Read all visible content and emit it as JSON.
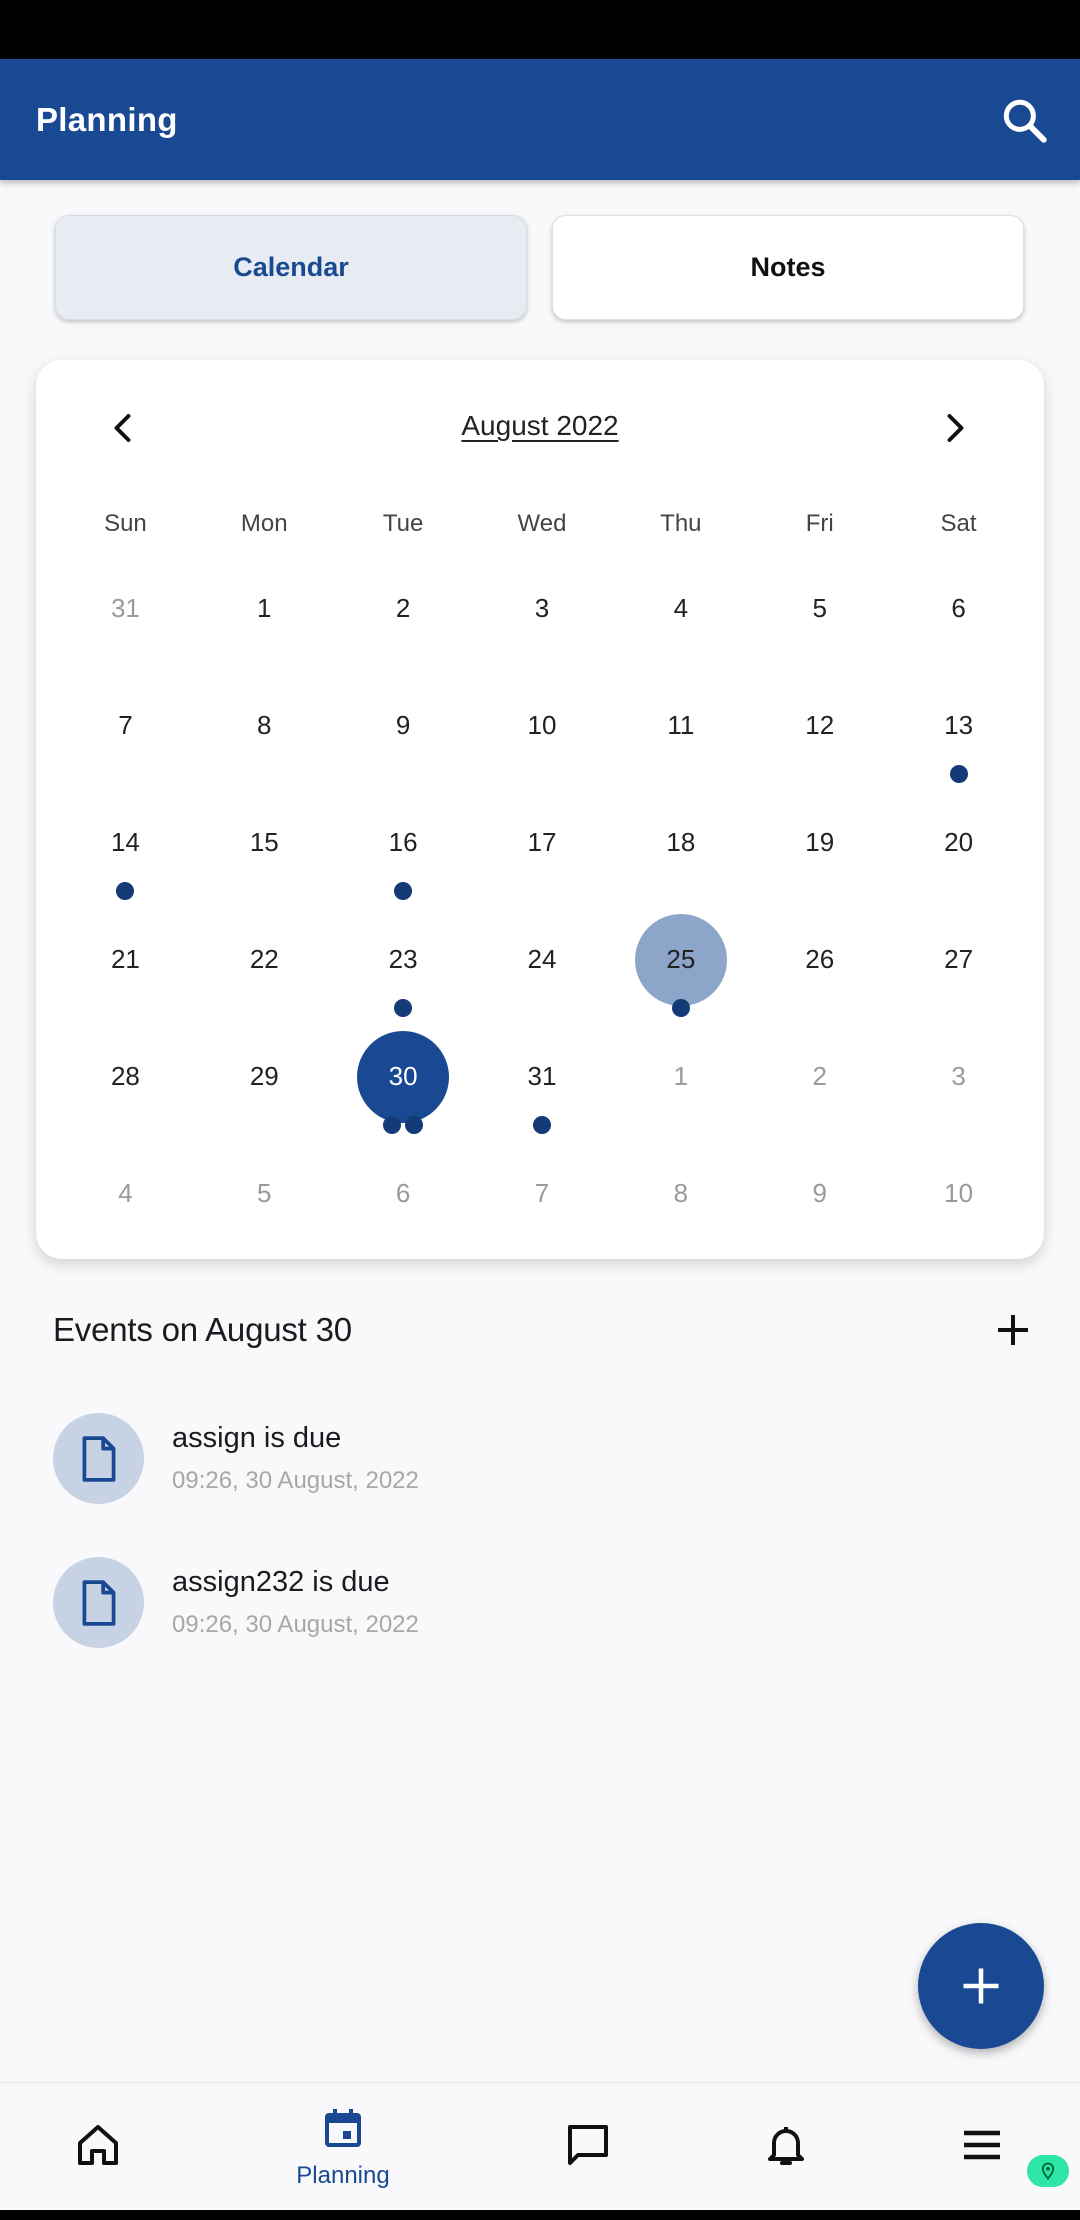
{
  "app": {
    "title": "Planning"
  },
  "segments": {
    "calendar": "Calendar",
    "notes": "Notes"
  },
  "calendar": {
    "month_label": "August 2022",
    "weekdays": [
      "Sun",
      "Mon",
      "Tue",
      "Wed",
      "Thu",
      "Fri",
      "Sat"
    ],
    "days": [
      {
        "d": "31",
        "muted": true,
        "dots": 0
      },
      {
        "d": "1",
        "dots": 0
      },
      {
        "d": "2",
        "dots": 0
      },
      {
        "d": "3",
        "dots": 0
      },
      {
        "d": "4",
        "dots": 0
      },
      {
        "d": "5",
        "dots": 0
      },
      {
        "d": "6",
        "dots": 0
      },
      {
        "d": "7",
        "dots": 0
      },
      {
        "d": "8",
        "dots": 0
      },
      {
        "d": "9",
        "dots": 0
      },
      {
        "d": "10",
        "dots": 0
      },
      {
        "d": "11",
        "dots": 0
      },
      {
        "d": "12",
        "dots": 0
      },
      {
        "d": "13",
        "dots": 1
      },
      {
        "d": "14",
        "dots": 1
      },
      {
        "d": "15",
        "dots": 0
      },
      {
        "d": "16",
        "dots": 1
      },
      {
        "d": "17",
        "dots": 0
      },
      {
        "d": "18",
        "dots": 0
      },
      {
        "d": "19",
        "dots": 0
      },
      {
        "d": "20",
        "dots": 0
      },
      {
        "d": "21",
        "dots": 0
      },
      {
        "d": "22",
        "dots": 0
      },
      {
        "d": "23",
        "dots": 1
      },
      {
        "d": "24",
        "dots": 0
      },
      {
        "d": "25",
        "dots": 1,
        "today": true
      },
      {
        "d": "26",
        "dots": 0
      },
      {
        "d": "27",
        "dots": 0
      },
      {
        "d": "28",
        "dots": 0
      },
      {
        "d": "29",
        "dots": 0
      },
      {
        "d": "30",
        "dots": 2,
        "selected": true
      },
      {
        "d": "31",
        "dots": 1
      },
      {
        "d": "1",
        "muted": true,
        "dots": 0
      },
      {
        "d": "2",
        "muted": true,
        "dots": 0
      },
      {
        "d": "3",
        "muted": true,
        "dots": 0
      },
      {
        "d": "4",
        "muted": true,
        "dots": 0
      },
      {
        "d": "5",
        "muted": true,
        "dots": 0
      },
      {
        "d": "6",
        "muted": true,
        "dots": 0
      },
      {
        "d": "7",
        "muted": true,
        "dots": 0
      },
      {
        "d": "8",
        "muted": true,
        "dots": 0
      },
      {
        "d": "9",
        "muted": true,
        "dots": 0
      },
      {
        "d": "10",
        "muted": true,
        "dots": 0
      }
    ]
  },
  "events": {
    "title": "Events on August 30",
    "items": [
      {
        "name": "assign is due",
        "time": "09:26, 30 August, 2022",
        "icon": "file-icon"
      },
      {
        "name": "assign232 is due",
        "time": "09:26, 30 August, 2022",
        "icon": "file-icon"
      }
    ]
  },
  "bottom_nav": {
    "items": [
      {
        "icon": "home-icon",
        "label": ""
      },
      {
        "icon": "calendar-icon",
        "label": "Planning",
        "active": true
      },
      {
        "icon": "chat-icon",
        "label": ""
      },
      {
        "icon": "bell-icon",
        "label": ""
      },
      {
        "icon": "menu-icon",
        "label": ""
      }
    ]
  },
  "colors": {
    "primary": "#1a4993",
    "today_circle": "#8ea5ca",
    "event_dot": "#143a78",
    "avatar_bg": "#c7d2e4"
  }
}
